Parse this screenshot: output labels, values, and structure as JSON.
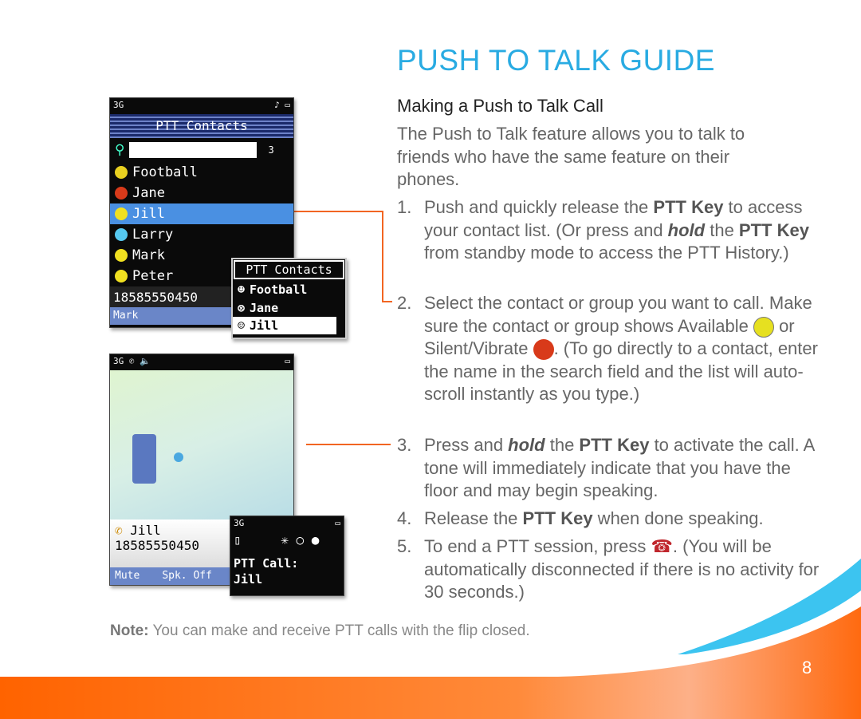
{
  "title": "PUSH TO TALK GUIDE",
  "subtitle": "Making a Push to Talk Call",
  "intro": "The Push to Talk feature allows you to talk to friends who have the same feature on their phones.",
  "steps": [
    {
      "n": "1.",
      "a": "Push and quickly release the ",
      "b": "PTT Key",
      "c": " to access your contact list. (Or press and ",
      "d": "hold",
      "e": " the ",
      "f": "PTT Key",
      "g": " from standby mode to access the PTT History.)"
    },
    {
      "n": "2.",
      "a": "Select the contact or group you want to call. Make sure the contact or group shows Available ",
      "b": " or Silent/Vibrate ",
      "c": ". (To go directly to a contact, enter the name in the search field and the list will auto-scroll instantly as you type.)"
    },
    {
      "n": "3.",
      "a": "Press and ",
      "b": "hold",
      "c": " the ",
      "d": "PTT Key",
      "e": " to activate the call. A tone will immediately indicate that you have the floor and may begin speaking."
    },
    {
      "n": "4.",
      "a": "Release the ",
      "b": "PTT Key",
      "c": " when done speaking."
    },
    {
      "n": "5.",
      "a": "To end a PTT session, press ",
      "b": ". (You will be automatically disconnected if there is no activity for 30 seconds.)"
    }
  ],
  "note": {
    "label": "Note:",
    "text": " You can make and receive PTT calls with the flip closed."
  },
  "page_number": "8",
  "phone1": {
    "status": "3G",
    "header": "PTT Contacts",
    "search_count": "3",
    "contacts": [
      {
        "name": "Football",
        "color": "#e8d020"
      },
      {
        "name": "Jane",
        "color": "#d83a1a"
      },
      {
        "name": "Jill",
        "color": "#f0e020"
      },
      {
        "name": "Larry",
        "color": "#55c8f0"
      },
      {
        "name": "Mark",
        "color": "#f0e020"
      },
      {
        "name": "Peter",
        "color": "#f0e020"
      }
    ],
    "number": "18585550450",
    "softkey": "Mark"
  },
  "popup1": {
    "header": "PTT Contacts",
    "items": [
      "Football",
      "Jane",
      "Jill"
    ]
  },
  "phone2": {
    "status": "3G",
    "name": "Jill",
    "number": "18585550450",
    "soft_left": "Mute",
    "soft_right": "Spk. Off"
  },
  "popup2": {
    "status": "3G",
    "line1": "PTT Call:",
    "line2": "Jill"
  },
  "colors": {
    "title": "#29abe2",
    "accent": "#f26522",
    "highlight": "#4a90e2"
  }
}
